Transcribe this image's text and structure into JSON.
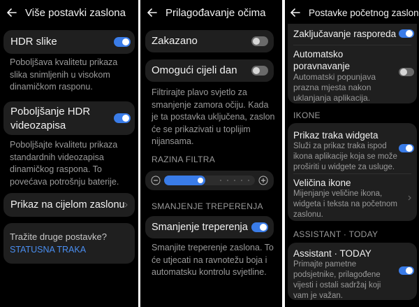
{
  "panel1": {
    "title": "Više postavki zaslona",
    "hdr_images": {
      "label": "HDR slike",
      "enabled": true,
      "description": [
        "Poboljšava kvalitetu prikaza",
        "slika snimljenih u visokom",
        "dinamičkom rasponu."
      ]
    },
    "hdr_video": {
      "label": [
        "Poboljšanje HDR",
        "videozapisa"
      ],
      "enabled": true,
      "description": [
        "Poboljšajte kvalitetu prikaza",
        "standardnih videozapisa",
        "dinamičkog raspona. To",
        "povećava potrošnju baterije."
      ]
    },
    "fullscreen": {
      "label": "Prikaz na cijelom zaslonu"
    },
    "suggestions": {
      "question": "Tražite druge postavke?",
      "link": "STATUSNA TRAKA"
    }
  },
  "panel2": {
    "title": "Prilagođavanje očima",
    "scheduled": {
      "label": "Zakazano",
      "enabled": false
    },
    "all_day": {
      "label": "Omogući cijeli dan",
      "enabled": false
    },
    "description": [
      "Filtrirajte plavo svjetlo za",
      "smanjenje zamora očiju. Kada",
      "je ta postavka uključena, zaslon",
      "će se prikazivati u toplijim",
      "nijansama."
    ],
    "filter_section": "RAZINA FILTRA",
    "filter_level": 0.45,
    "flicker_section": "SMANJENJE TREPERENJA",
    "flicker": {
      "label": "Smanjenje treperenja",
      "enabled": true,
      "description": [
        "Smanjite treperenje zaslona. To",
        "će utjecati na ravnotežu boja i",
        "automatsku kontrolu svjetline."
      ]
    }
  },
  "panel3": {
    "title": "Postavke početnog zaslona",
    "lock_layout": {
      "label": "Zaključavanje rasporeda",
      "enabled": true
    },
    "auto_align": {
      "label": [
        "Automatsko",
        "poravnavanje"
      ],
      "enabled": false,
      "description": [
        "Automatski popunjava",
        "prazna mjesta nakon",
        "uklanjanja aplikacija."
      ]
    },
    "icons_section": "IKONE",
    "widget_bars": {
      "label": "Prikaz traka widgeta",
      "enabled": true,
      "description": [
        "Služi za prikaz traka ispod",
        "ikona aplikacije koja se može",
        "proširiti u widgete za usluge."
      ]
    },
    "icon_size": {
      "label": "Veličina ikone",
      "description": [
        "Mijenjanje veličine ikona,",
        "widgeta i teksta na početnom",
        "zaslonu."
      ]
    },
    "assistant_section": "ASSISTANT · TODAY",
    "assistant": {
      "label": "Assistant · TODAY",
      "enabled": true,
      "description": [
        "Primajte pametne",
        "podsjetnike, prilagođene",
        "vijesti i ostali sadržaj koji",
        "vam je važan."
      ]
    }
  },
  "colors": {
    "accent": "#3a7ce8",
    "card": "#1f1f1f",
    "background": "#000000",
    "link": "#4a8ef0"
  }
}
